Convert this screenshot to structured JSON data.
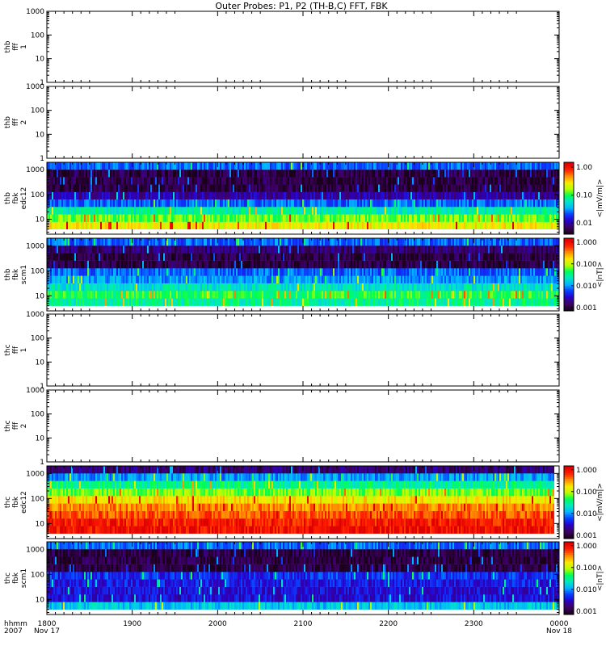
{
  "title": "Outer Probes: P1, P2 (TH-B,C) FFT, FBK",
  "colors": {
    "axis": "#000000",
    "background": "#ffffff",
    "colormap": [
      "#1a001a",
      "#3d0063",
      "#2a00c8",
      "#0a3cff",
      "#00b4ff",
      "#00e6c8",
      "#00ff50",
      "#b4ff00",
      "#ffe600",
      "#ff8c00",
      "#ff1e00",
      "#dc0000"
    ]
  },
  "x_axis": {
    "label_line1": "hhmm",
    "label_line2": "2007",
    "ticks": [
      {
        "value": 1800,
        "label": "1800",
        "sublabel": "Nov 17"
      },
      {
        "value": 1900,
        "label": "1900",
        "sublabel": ""
      },
      {
        "value": 2000,
        "label": "2000",
        "sublabel": ""
      },
      {
        "value": 2100,
        "label": "2100",
        "sublabel": ""
      },
      {
        "value": 2200,
        "label": "2200",
        "sublabel": ""
      },
      {
        "value": 2300,
        "label": "2300",
        "sublabel": ""
      },
      {
        "value": 2400,
        "label": "0000",
        "sublabel": "Nov 18"
      }
    ]
  },
  "chart_data": [
    {
      "type": "heatmap",
      "label_lines": [
        "thb",
        "fff",
        "1"
      ],
      "has_data": false,
      "yscale": "log",
      "ylim": [
        1,
        1000
      ],
      "y_ticks": [
        {
          "value": 1,
          "label": "1"
        },
        {
          "value": 10,
          "label": "10"
        },
        {
          "value": 100,
          "label": "100"
        },
        {
          "value": 1000,
          "label": "1000"
        }
      ],
      "xlim": [
        1800,
        2400
      ]
    },
    {
      "type": "heatmap",
      "label_lines": [
        "thb",
        "fff",
        "2"
      ],
      "has_data": false,
      "yscale": "log",
      "ylim": [
        1,
        1000
      ],
      "y_ticks": [
        {
          "value": 1,
          "label": "1"
        },
        {
          "value": 10,
          "label": "10"
        },
        {
          "value": 100,
          "label": "100"
        },
        {
          "value": 1000,
          "label": "1000"
        }
      ],
      "xlim": [
        1800,
        2400
      ]
    },
    {
      "type": "heatmap",
      "label_lines": [
        "thb",
        "fbk",
        "edc12"
      ],
      "has_data": true,
      "yscale": "log",
      "ylim": [
        2.5,
        2000
      ],
      "y_ticks": [
        {
          "value": 10,
          "label": "10"
        },
        {
          "value": 100,
          "label": "100"
        },
        {
          "value": 1000,
          "label": "1000"
        }
      ],
      "xlim": [
        1800,
        2400
      ],
      "bins": [
        4,
        8,
        16,
        32,
        64,
        128,
        256,
        512,
        1024,
        2048
      ],
      "levels": [
        0.7,
        0.6,
        0.48,
        0.3,
        0.15,
        0.05,
        0.05,
        0.05,
        0.3
      ],
      "data_end": 2400,
      "colorbar": {
        "label": "<|mV/m|>",
        "scale": "log",
        "range": [
          0.004,
          1.5
        ],
        "ticks": [
          {
            "value": 0.01,
            "label": "0.01"
          },
          {
            "value": 0.1,
            "label": "0.10"
          },
          {
            "value": 1,
            "label": "1.00"
          }
        ]
      }
    },
    {
      "type": "heatmap",
      "label_lines": [
        "thb",
        "fbk",
        "scm1"
      ],
      "has_data": true,
      "yscale": "log",
      "ylim": [
        2.5,
        2000
      ],
      "y_ticks": [
        {
          "value": 10,
          "label": "10"
        },
        {
          "value": 100,
          "label": "100"
        },
        {
          "value": 1000,
          "label": "1000"
        }
      ],
      "xlim": [
        1800,
        2400
      ],
      "bins": [
        4,
        8,
        16,
        32,
        64,
        128,
        256,
        512,
        1024,
        2048
      ],
      "levels": [
        0.5,
        0.55,
        0.45,
        0.35,
        0.3,
        0.05,
        0.05,
        0.1,
        0.3
      ],
      "data_end": 2400,
      "colorbar": {
        "label": "<|nT|>",
        "scale": "log",
        "range": [
          0.0007,
          1.5
        ],
        "ticks": [
          {
            "value": 0.001,
            "label": "0.001"
          },
          {
            "value": 0.01,
            "label": "0.010"
          },
          {
            "value": 0.1,
            "label": "0.100"
          },
          {
            "value": 1,
            "label": "1.000"
          }
        ]
      }
    },
    {
      "type": "heatmap",
      "label_lines": [
        "thc",
        "fff",
        "1"
      ],
      "has_data": false,
      "yscale": "log",
      "ylim": [
        1,
        1000
      ],
      "y_ticks": [
        {
          "value": 1,
          "label": "1"
        },
        {
          "value": 10,
          "label": "10"
        },
        {
          "value": 100,
          "label": "100"
        },
        {
          "value": 1000,
          "label": "1000"
        }
      ],
      "xlim": [
        1800,
        2400
      ]
    },
    {
      "type": "heatmap",
      "label_lines": [
        "thc",
        "fff",
        "2"
      ],
      "has_data": false,
      "yscale": "log",
      "ylim": [
        1,
        1000
      ],
      "y_ticks": [
        {
          "value": 1,
          "label": "1"
        },
        {
          "value": 10,
          "label": "10"
        },
        {
          "value": 100,
          "label": "100"
        },
        {
          "value": 1000,
          "label": "1000"
        }
      ],
      "xlim": [
        1800,
        2400
      ]
    },
    {
      "type": "heatmap",
      "label_lines": [
        "thc",
        "fbk",
        "edc12"
      ],
      "has_data": true,
      "yscale": "log",
      "ylim": [
        2.5,
        2000
      ],
      "y_ticks": [
        {
          "value": 10,
          "label": "10"
        },
        {
          "value": 100,
          "label": "100"
        },
        {
          "value": 1000,
          "label": "1000"
        }
      ],
      "xlim": [
        1800,
        2400
      ],
      "bins": [
        4,
        8,
        16,
        32,
        64,
        128,
        256,
        512,
        1024,
        2048
      ],
      "levels": [
        0.95,
        0.93,
        0.87,
        0.82,
        0.72,
        0.6,
        0.5,
        0.35,
        0.1
      ],
      "data_end": 2394,
      "colorbar": {
        "label": "<|mV/m|>",
        "scale": "log",
        "range": [
          0.0007,
          1.5
        ],
        "ticks": [
          {
            "value": 0.001,
            "label": "0.001"
          },
          {
            "value": 0.01,
            "label": "0.010"
          },
          {
            "value": 0.1,
            "label": "0.100"
          },
          {
            "value": 1,
            "label": "1.000"
          }
        ]
      }
    },
    {
      "type": "heatmap",
      "label_lines": [
        "thc",
        "fbk",
        "scm1"
      ],
      "has_data": true,
      "yscale": "log",
      "ylim": [
        2.5,
        2000
      ],
      "y_ticks": [
        {
          "value": 10,
          "label": "10"
        },
        {
          "value": 100,
          "label": "100"
        },
        {
          "value": 1000,
          "label": "1000"
        }
      ],
      "xlim": [
        1800,
        2400
      ],
      "bins": [
        4,
        8,
        16,
        32,
        64,
        128,
        256,
        512,
        1024,
        2048
      ],
      "levels": [
        0.4,
        0.2,
        0.2,
        0.22,
        0.25,
        0.05,
        0.05,
        0.05,
        0.3
      ],
      "data_end": 2400,
      "colorbar": {
        "label": "<|nT|>",
        "scale": "log",
        "range": [
          0.0007,
          1.5
        ],
        "ticks": [
          {
            "value": 0.001,
            "label": "0.001"
          },
          {
            "value": 0.01,
            "label": "0.010"
          },
          {
            "value": 0.1,
            "label": "0.100"
          },
          {
            "value": 1,
            "label": "1.000"
          }
        ]
      }
    }
  ]
}
